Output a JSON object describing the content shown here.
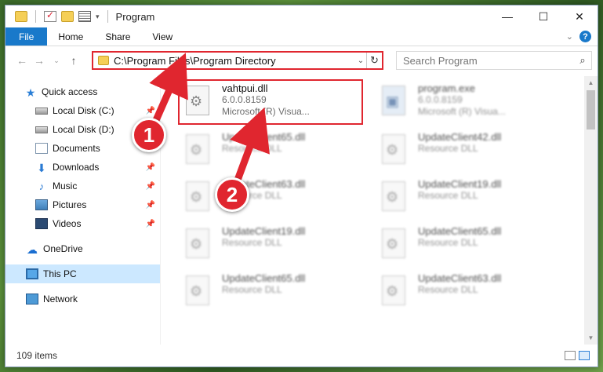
{
  "window": {
    "title": "Program",
    "caption": {
      "minimize": "—",
      "maximize": "☐",
      "close": "✕"
    }
  },
  "ribbon": {
    "tabs": [
      "File",
      "Home",
      "Share",
      "View"
    ]
  },
  "address": {
    "path": "C:\\Program Files\\Program Directory"
  },
  "search": {
    "placeholder": "Search Program"
  },
  "sidebar": {
    "items": [
      {
        "label": "Quick access",
        "icon": "star-icon"
      },
      {
        "label": "Local Disk (C:)",
        "icon": "disk-icon",
        "pinned": true
      },
      {
        "label": "Local Disk (D:)",
        "icon": "disk-icon",
        "pinned": true
      },
      {
        "label": "Documents",
        "icon": "documents-icon",
        "pinned": true
      },
      {
        "label": "Downloads",
        "icon": "download-icon",
        "pinned": true
      },
      {
        "label": "Music",
        "icon": "music-icon",
        "pinned": true
      },
      {
        "label": "Pictures",
        "icon": "pictures-icon",
        "pinned": true
      },
      {
        "label": "Videos",
        "icon": "videos-icon",
        "pinned": true
      },
      {
        "label": "OneDrive",
        "icon": "cloud-icon"
      },
      {
        "label": "This PC",
        "icon": "pc-icon",
        "selected": true
      },
      {
        "label": "Network",
        "icon": "network-icon"
      }
    ]
  },
  "files": [
    {
      "name": "vahtpui.dll",
      "line2": "6.0.0.8159",
      "line3": "Microsoft (R) Visua..."
    },
    {
      "name": "program.exe",
      "line2": "6.0.0.8159",
      "line3": "Microsoft (R) Visua..."
    },
    {
      "name": "UpdateClient65.dll",
      "line2": "Resource DLL"
    },
    {
      "name": "UpdateClient42.dll",
      "line2": "Resource DLL"
    },
    {
      "name": "UpdateClient63.dll",
      "line2": "Resource DLL"
    },
    {
      "name": "UpdateClient19.dll",
      "line2": "Resource DLL"
    },
    {
      "name": "UpdateClient19.dll",
      "line2": "Resource DLL"
    },
    {
      "name": "UpdateClient65.dll",
      "line2": "Resource DLL"
    },
    {
      "name": "UpdateClient65.dll",
      "line2": "Resource DLL"
    },
    {
      "name": "UpdateClient63.dll",
      "line2": "Resource DLL"
    }
  ],
  "status": {
    "items": "109 items"
  },
  "callouts": [
    "1",
    "2"
  ],
  "colors": {
    "accent": "#1979ca",
    "highlight": "#e0262f"
  }
}
